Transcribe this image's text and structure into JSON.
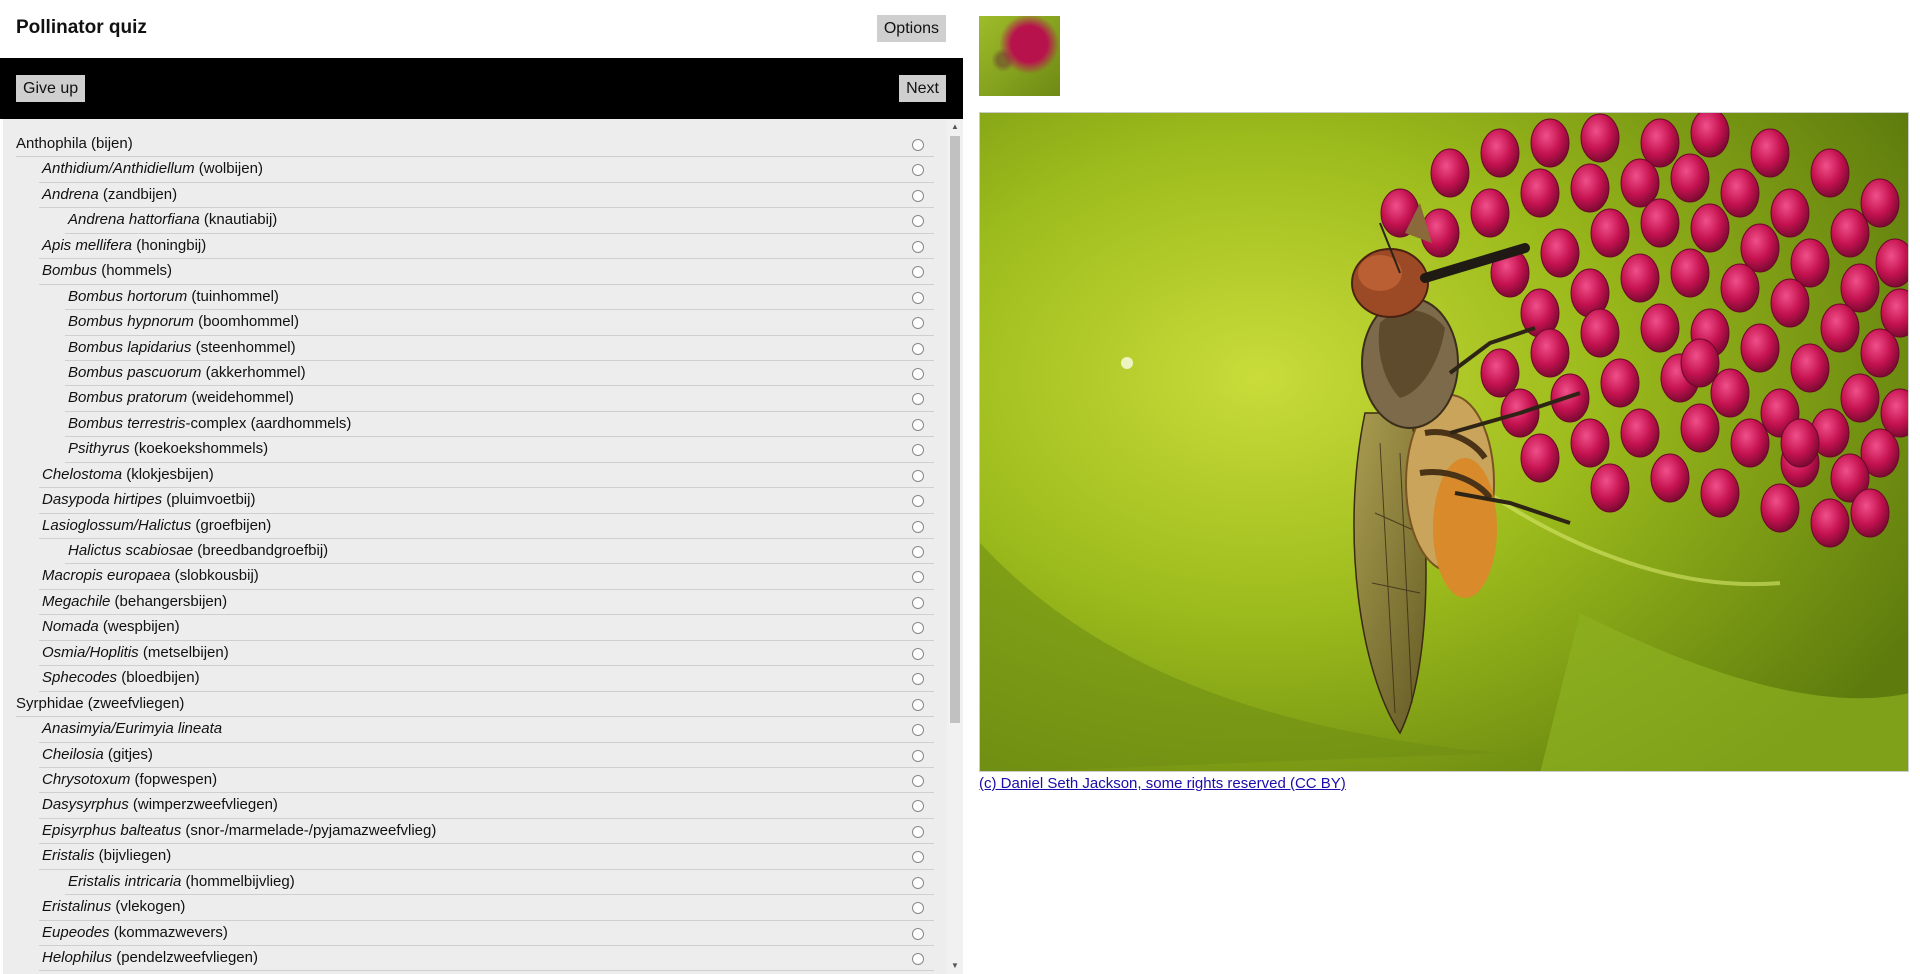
{
  "header": {
    "title": "Pollinator quiz",
    "options_label": "Options"
  },
  "toolbar": {
    "give_up_label": "Give up",
    "next_label": "Next"
  },
  "scrollbar": {
    "up_arrow": "▲",
    "down_arrow": "▼"
  },
  "taxa": [
    {
      "level": 0,
      "sci": "",
      "common": "Anthophila (bijen)"
    },
    {
      "level": 1,
      "sci": "Anthidium/Anthidiellum",
      "common": " (wolbijen)"
    },
    {
      "level": 1,
      "sci": "Andrena",
      "common": " (zandbijen)"
    },
    {
      "level": 2,
      "sci": "Andrena hattorfiana",
      "common": " (knautiabij)"
    },
    {
      "level": 1,
      "sci": "Apis mellifera",
      "common": " (honingbij)"
    },
    {
      "level": 1,
      "sci": "Bombus",
      "common": " (hommels)"
    },
    {
      "level": 2,
      "sci": "Bombus hortorum",
      "common": " (tuinhommel)"
    },
    {
      "level": 2,
      "sci": "Bombus hypnorum",
      "common": " (boomhommel)"
    },
    {
      "level": 2,
      "sci": "Bombus lapidarius",
      "common": " (steenhommel)"
    },
    {
      "level": 2,
      "sci": "Bombus pascuorum",
      "common": " (akkerhommel)"
    },
    {
      "level": 2,
      "sci": "Bombus pratorum",
      "common": " (weidehommel)"
    },
    {
      "level": 2,
      "sci": "Bombus terrestris",
      "common": "-complex (aardhommels)"
    },
    {
      "level": 2,
      "sci": "Psithyrus",
      "common": " (koekoekshommels)"
    },
    {
      "level": 1,
      "sci": "Chelostoma",
      "common": " (klokjesbijen)"
    },
    {
      "level": 1,
      "sci": "Dasypoda hirtipes",
      "common": " (pluimvoetbij)"
    },
    {
      "level": 1,
      "sci": "Lasioglossum/Halictus",
      "common": " (groefbijen)"
    },
    {
      "level": 2,
      "sci": "Halictus scabiosae",
      "common": " (breedbandgroefbij)"
    },
    {
      "level": 1,
      "sci": "Macropis europaea",
      "common": " (slobkousbij)"
    },
    {
      "level": 1,
      "sci": "Megachile",
      "common": " (behangersbijen)"
    },
    {
      "level": 1,
      "sci": "Nomada",
      "common": " (wespbijen)"
    },
    {
      "level": 1,
      "sci": "Osmia/Hoplitis",
      "common": " (metselbijen)"
    },
    {
      "level": 1,
      "sci": "Sphecodes",
      "common": " (bloedbijen)"
    },
    {
      "level": 0,
      "sci": "",
      "common": "Syrphidae (zweefvliegen)"
    },
    {
      "level": 1,
      "sci": "Anasimyia/Eurimyia lineata",
      "common": ""
    },
    {
      "level": 1,
      "sci": "Cheilosia",
      "common": " (gitjes)"
    },
    {
      "level": 1,
      "sci": "Chrysotoxum",
      "common": " (fopwespen)"
    },
    {
      "level": 1,
      "sci": "Dasysyrphus",
      "common": " (wimperzweefvliegen)"
    },
    {
      "level": 1,
      "sci": "Episyrphus balteatus",
      "common": " (snor-/marmelade-/pyjamazweefvlieg)"
    },
    {
      "level": 1,
      "sci": "Eristalis",
      "common": " (bijvliegen)"
    },
    {
      "level": 2,
      "sci": "Eristalis intricaria",
      "common": " (hommelbijvlieg)"
    },
    {
      "level": 1,
      "sci": "Eristalinus",
      "common": " (vlekogen)"
    },
    {
      "level": 1,
      "sci": "Eupeodes",
      "common": " (kommazwevers)"
    },
    {
      "level": 1,
      "sci": "Helophilus",
      "common": " (pendelzweefvliegen)"
    }
  ],
  "photo": {
    "credit": "(c) Daniel Seth Jackson, some rights reserved (CC BY)"
  }
}
